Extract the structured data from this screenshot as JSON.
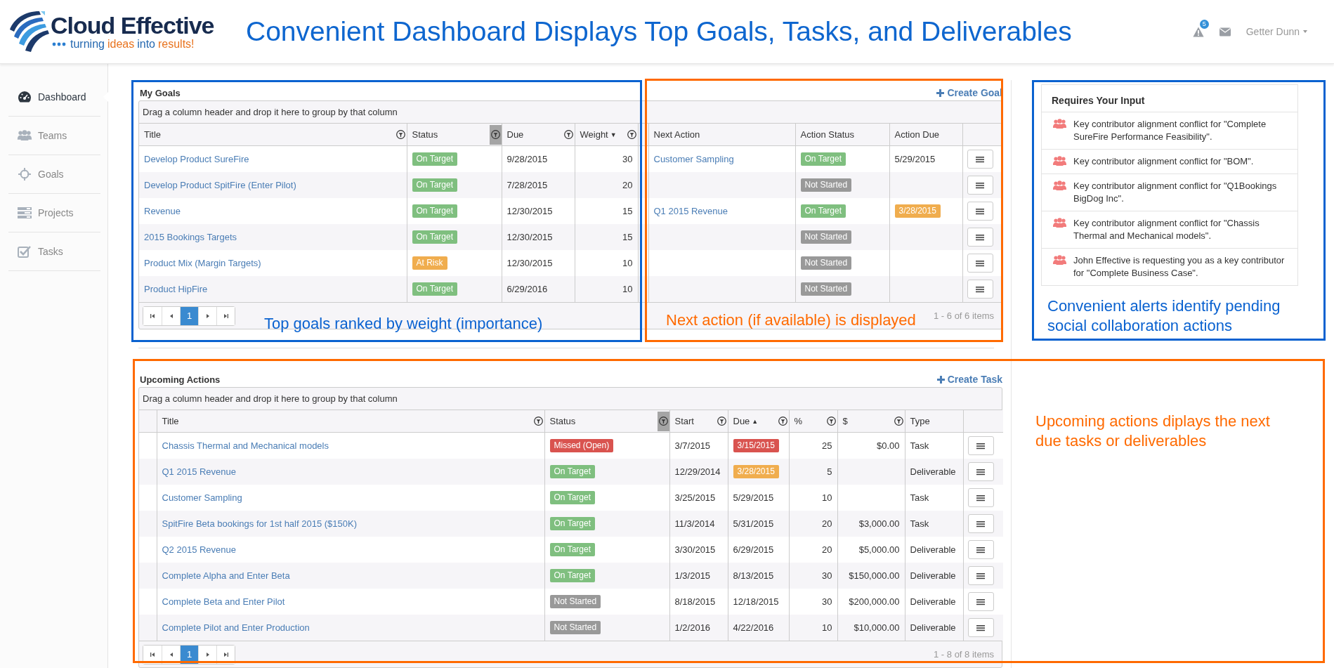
{
  "header": {
    "logo": {
      "name": "Cloud Effective",
      "tagline": [
        {
          "text": "turning",
          "accent": false
        },
        {
          "text": "ideas",
          "accent": true
        },
        {
          "text": "into",
          "accent": false
        },
        {
          "text": "results!",
          "accent": true
        }
      ]
    },
    "headline": "Convenient Dashboard Displays Top Goals, Tasks, and Deliverables",
    "alert_count": "5",
    "user": "Getter Dunn"
  },
  "sidebar": {
    "items": [
      {
        "label": "Dashboard",
        "selected": true
      },
      {
        "label": "Teams",
        "selected": false
      },
      {
        "label": "Goals",
        "selected": false
      },
      {
        "label": "Projects",
        "selected": false
      },
      {
        "label": "Tasks",
        "selected": false
      }
    ]
  },
  "my_goals": {
    "title": "My Goals",
    "action": "Create Goal",
    "group_hint": "Drag a column header and drop it here to group by that column",
    "columns": [
      {
        "label": "Title",
        "filter": true,
        "filtered": false
      },
      {
        "label": "Status",
        "filter": true,
        "filtered": true
      },
      {
        "label": "Due",
        "filter": true,
        "filtered": false
      },
      {
        "label": "Weight",
        "filter": true,
        "filtered": false,
        "sort": "▼"
      },
      {
        "label": "Next Action",
        "filter": false
      },
      {
        "label": "Action Status",
        "filter": false
      },
      {
        "label": "Action Due",
        "filter": false
      }
    ],
    "rows": [
      {
        "title": "Develop Product SureFire",
        "status": {
          "label": "On Target",
          "color": "#7fbf7f"
        },
        "due": "9/28/2015",
        "weight": "30",
        "next_action": "Customer Sampling",
        "action_status": {
          "label": "On Target",
          "color": "#7fbf7f"
        },
        "action_due": {
          "text": "5/29/2015"
        }
      },
      {
        "title": "Develop Product SpitFire (Enter Pilot)",
        "status": {
          "label": "On Target",
          "color": "#7fbf7f"
        },
        "due": "7/28/2015",
        "weight": "20",
        "action_status": {
          "label": "Not Started",
          "color": "#999999"
        }
      },
      {
        "title": "Revenue",
        "status": {
          "label": "On Target",
          "color": "#7fbf7f"
        },
        "due": "12/30/2015",
        "weight": "15",
        "next_action": "Q1 2015 Revenue",
        "action_status": {
          "label": "On Target",
          "color": "#7fbf7f"
        },
        "action_due": {
          "text": "3/28/2015",
          "color": "#f0ad4e"
        }
      },
      {
        "title": "2015 Bookings Targets",
        "status": {
          "label": "On Target",
          "color": "#7fbf7f"
        },
        "due": "12/30/2015",
        "weight": "15",
        "action_status": {
          "label": "Not Started",
          "color": "#999999"
        }
      },
      {
        "title": "Product Mix (Margin Targets)",
        "status": {
          "label": "At Risk",
          "color": "#f0ad4e"
        },
        "due": "12/30/2015",
        "weight": "10",
        "action_status": {
          "label": "Not Started",
          "color": "#999999"
        }
      },
      {
        "title": "Product HipFire",
        "status": {
          "label": "On Target",
          "color": "#7fbf7f"
        },
        "due": "6/29/2016",
        "weight": "10",
        "action_status": {
          "label": "Not Started",
          "color": "#999999"
        }
      }
    ],
    "pages": [
      {
        "label": "1",
        "selected": true
      }
    ],
    "pager_info": "1 - 6 of 6 items"
  },
  "upcoming_actions": {
    "title": "Upcoming Actions",
    "action": "Create Task",
    "group_hint": "Drag a column header and drop it here to group by that column",
    "columns": [
      {
        "label": "Title",
        "filter": true,
        "filtered": false
      },
      {
        "label": "Status",
        "filter": true,
        "filtered": true
      },
      {
        "label": "Start",
        "filter": true,
        "filtered": false
      },
      {
        "label": "Due",
        "filter": true,
        "filtered": false,
        "sort": "▲"
      },
      {
        "label": "%",
        "filter": true,
        "filtered": false
      },
      {
        "label": "$",
        "filter": true,
        "filtered": false
      },
      {
        "label": "Type",
        "filter": false
      }
    ],
    "rows": [
      {
        "title": "Chassis Thermal and Mechanical models",
        "status": {
          "label": "Missed (Open)",
          "color": "#d9534f"
        },
        "start": "3/7/2015",
        "due": {
          "text": "3/15/2015",
          "color": "#d9534f"
        },
        "percent": "25",
        "amount": "$0.00",
        "type": "Task"
      },
      {
        "title": "Q1 2015 Revenue",
        "status": {
          "label": "On Target",
          "color": "#7fbf7f"
        },
        "start": "12/29/2014",
        "due": {
          "text": "3/28/2015",
          "color": "#f0ad4e"
        },
        "percent": "5",
        "type": "Deliverable"
      },
      {
        "title": "Customer Sampling",
        "status": {
          "label": "On Target",
          "color": "#7fbf7f"
        },
        "start": "3/25/2015",
        "due": {
          "text": "5/29/2015"
        },
        "percent": "10",
        "type": "Task"
      },
      {
        "title": "SpitFire Beta bookings for 1st half 2015 ($150K)",
        "status": {
          "label": "On Target",
          "color": "#7fbf7f"
        },
        "start": "11/3/2014",
        "due": {
          "text": "5/31/2015"
        },
        "percent": "20",
        "amount": "$3,000.00",
        "type": "Task"
      },
      {
        "title": "Q2 2015 Revenue",
        "status": {
          "label": "On Target",
          "color": "#7fbf7f"
        },
        "start": "3/30/2015",
        "due": {
          "text": "6/29/2015"
        },
        "percent": "20",
        "amount": "$5,000.00",
        "type": "Deliverable"
      },
      {
        "title": "Complete Alpha and Enter Beta",
        "status": {
          "label": "On Target",
          "color": "#7fbf7f"
        },
        "start": "1/3/2015",
        "due": {
          "text": "8/13/2015"
        },
        "percent": "30",
        "amount": "$150,000.00",
        "type": "Deliverable"
      },
      {
        "title": "Complete Beta and Enter Pilot",
        "status": {
          "label": "Not Started",
          "color": "#999999"
        },
        "start": "8/18/2015",
        "due": {
          "text": "12/18/2015"
        },
        "percent": "30",
        "amount": "$200,000.00",
        "type": "Deliverable"
      },
      {
        "title": "Complete Pilot and Enter Production",
        "status": {
          "label": "Not Started",
          "color": "#999999"
        },
        "start": "1/2/2016",
        "due": {
          "text": "4/22/2016"
        },
        "percent": "10",
        "amount": "$10,000.00",
        "type": "Deliverable"
      }
    ],
    "pages": [
      {
        "label": "1",
        "selected": true
      }
    ],
    "pager_info": "1 - 8 of 8 items"
  },
  "requires_input": {
    "title": "Requires Your Input",
    "items": [
      "Key contributor alignment conflict for \"Complete SureFire Performance Feasibility\".",
      "Key contributor alignment conflict for \"BOM\".",
      "Key contributor alignment conflict for \"Q1Bookings BigDog Inc\".",
      "Key contributor alignment conflict for \"Chassis Thermal and Mechanical models\".",
      "John Effective is requesting you as a key contributor for \"Complete Business Case\"."
    ]
  },
  "annotations": [
    {
      "text": "Top goals ranked by weight (importance)",
      "color": "#0a62d0"
    },
    {
      "text": "Next action (if available) is displayed",
      "color": "#ff6a00"
    },
    {
      "text": "Convenient alerts identify pending social collaboration actions",
      "color": "#0a62d0"
    },
    {
      "text": "Upcoming actions diplays the next due tasks or deliverables",
      "color": "#ff6a00"
    }
  ],
  "frames": [
    {
      "color": "#0a62d0"
    },
    {
      "color": "#ff6a00"
    },
    {
      "color": "#0a62d0"
    },
    {
      "color": "#ff6a00"
    }
  ]
}
